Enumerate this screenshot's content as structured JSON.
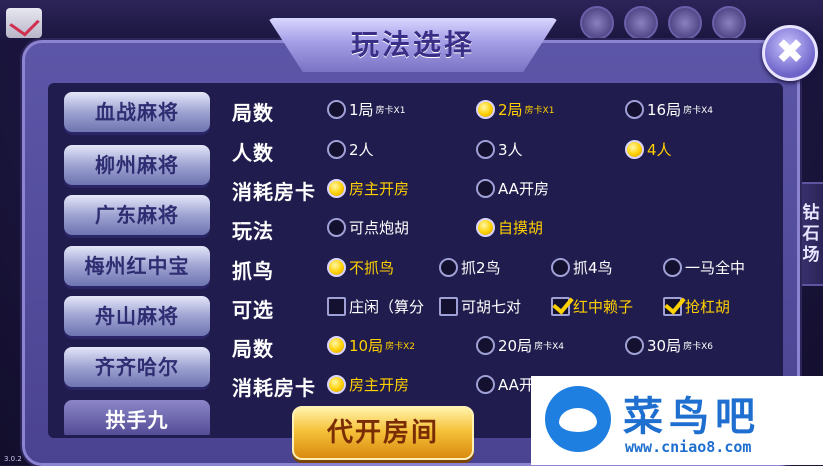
{
  "dialog": {
    "title": "玩法选择",
    "close_label": "✖",
    "side_tab": "钻石场",
    "open_room_button": "代开房间"
  },
  "games": [
    {
      "label": "血战麻将",
      "selected": false
    },
    {
      "label": "柳州麻将",
      "selected": false
    },
    {
      "label": "广东麻将",
      "selected": false
    },
    {
      "label": "梅州红中宝",
      "selected": false
    },
    {
      "label": "舟山麻将",
      "selected": false
    },
    {
      "label": "齐齐哈尔",
      "selected": false
    },
    {
      "label": "拱手九",
      "selected": true
    }
  ],
  "rows": [
    {
      "label": "局数",
      "options": [
        {
          "text": "1局",
          "sub": "房卡X1",
          "selected": false
        },
        {
          "text": "2局",
          "sub": "房卡X1",
          "selected": true
        },
        {
          "text": "16局",
          "sub": "房卡X4",
          "selected": false
        }
      ]
    },
    {
      "label": "人数",
      "options": [
        {
          "text": "2人",
          "selected": false
        },
        {
          "text": "3人",
          "selected": false
        },
        {
          "text": "4人",
          "selected": true
        }
      ]
    },
    {
      "label": "消耗房卡",
      "options": [
        {
          "text": "房主开房",
          "selected": true
        },
        {
          "text": "AA开房",
          "selected": false
        }
      ]
    },
    {
      "label": "玩法",
      "options": [
        {
          "text": "可点炮胡",
          "selected": false
        },
        {
          "text": "自摸胡",
          "selected": true
        }
      ]
    },
    {
      "label": "抓鸟",
      "options": [
        {
          "text": "不抓鸟",
          "selected": true
        },
        {
          "text": "抓2鸟",
          "selected": false
        },
        {
          "text": "抓4鸟",
          "selected": false
        },
        {
          "text": "一马全中",
          "selected": false
        }
      ]
    },
    {
      "label": "可选",
      "options": [
        {
          "text": "庄闲（算分",
          "selected": false
        },
        {
          "text": "可胡七对",
          "selected": false
        },
        {
          "text": "红中赖子",
          "selected": true
        },
        {
          "text": "抢杠胡",
          "selected": true
        }
      ]
    },
    {
      "label": "局数",
      "options": [
        {
          "text": "10局",
          "sub": "房卡X2",
          "selected": true
        },
        {
          "text": "20局",
          "sub": "房卡X4",
          "selected": false
        },
        {
          "text": "30局",
          "sub": "房卡X6",
          "selected": false
        }
      ]
    },
    {
      "label": "消耗房卡",
      "options": [
        {
          "text": "房主开房",
          "selected": true
        },
        {
          "text": "AA开",
          "selected": false
        }
      ]
    }
  ],
  "watermark": {
    "title": "菜鸟吧",
    "url": "www.cniao8.com"
  },
  "version": "3.0.2",
  "colors": {
    "selected_text": "#ffd000",
    "panel_bg": "#201c4d",
    "dialog_bg": "#5d56a8",
    "button_gold": "#f6c23a"
  }
}
